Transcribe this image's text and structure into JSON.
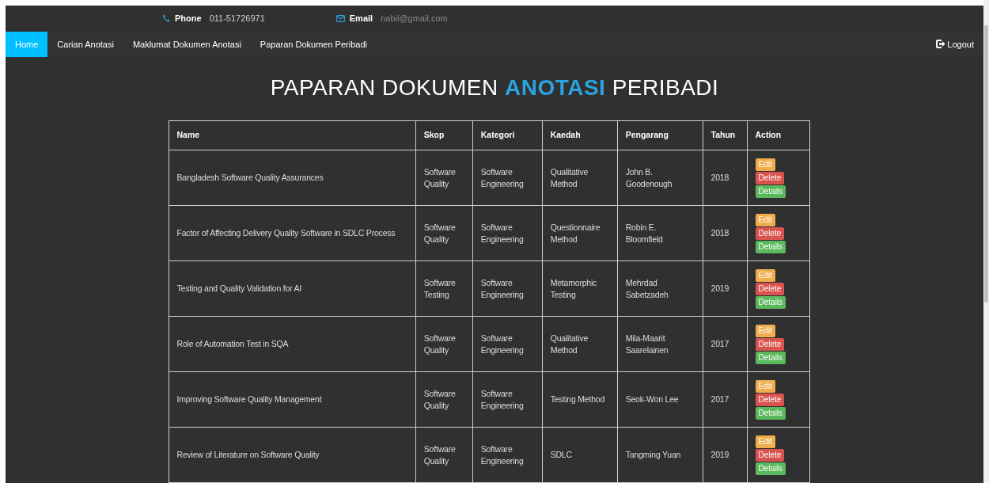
{
  "contact": {
    "phone_label": "Phone",
    "phone": "011-51726971",
    "email_label": "Email",
    "email": "nabil@gmail.com"
  },
  "nav": {
    "items": [
      {
        "label": "Home",
        "selected": true
      },
      {
        "label": "Carian Anotasi",
        "selected": false
      },
      {
        "label": "Maklumat Dokumen Anotasi",
        "selected": false
      },
      {
        "label": "Paparan Dokumen Peribadi",
        "selected": false
      }
    ],
    "logout": "Logout"
  },
  "heading": {
    "before": "PAPARAN DOKUMEN",
    "highlight": "ANOTASI",
    "after": "PERIBADI"
  },
  "table": {
    "columns": [
      "Name",
      "Skop",
      "Kategori",
      "Kaedah",
      "Pengarang",
      "Tahun",
      "Action"
    ],
    "rows": [
      {
        "cells": [
          "Bangladesh Software Quality Assurances",
          "Software Quality",
          "Software Engineering",
          "Qualitative Method",
          "John B. Goodenough",
          "2018"
        ],
        "actions": [
          "Edit",
          "Delete",
          "Details"
        ]
      },
      {
        "cells": [
          "Factor of Affecting Delivery Quality Software in SDLC Process",
          "Software Quality",
          "Software Engineering",
          "Questionnaire Method",
          "Robin E. Bloomfield",
          "2018"
        ],
        "actions": [
          "Edit",
          "Delete",
          "Details"
        ]
      },
      {
        "cells": [
          "Testing and Quality Validation for AI",
          "Software Testing",
          "Software Engineering",
          "Metamorphic Testing",
          "Mehrdad Sabetzadeh",
          "2019"
        ],
        "actions": [
          "Edit",
          "Delete",
          "Details"
        ]
      },
      {
        "cells": [
          "Role of Automation Test in SQA",
          "Software Quality",
          "Software Engineering",
          "Qualitative Method",
          "Mila-Maarit Saarelainen",
          "2017"
        ],
        "actions": [
          "Edit",
          "Delete",
          "Details"
        ]
      },
      {
        "cells": [
          "Improving Software Quality Management",
          "Software Quality",
          "Software Engineering",
          "Testing Method",
          "Seok-Won Lee",
          "2017"
        ],
        "actions": [
          "Edit",
          "Delete",
          "Details"
        ]
      },
      {
        "cells": [
          "Review of Literature on Software Quality",
          "Software Quality",
          "Software Engineering",
          "SDLC",
          "Tangming Yuan",
          "2019"
        ],
        "actions": [
          "Edit",
          "Delete",
          "Details"
        ]
      }
    ]
  }
}
